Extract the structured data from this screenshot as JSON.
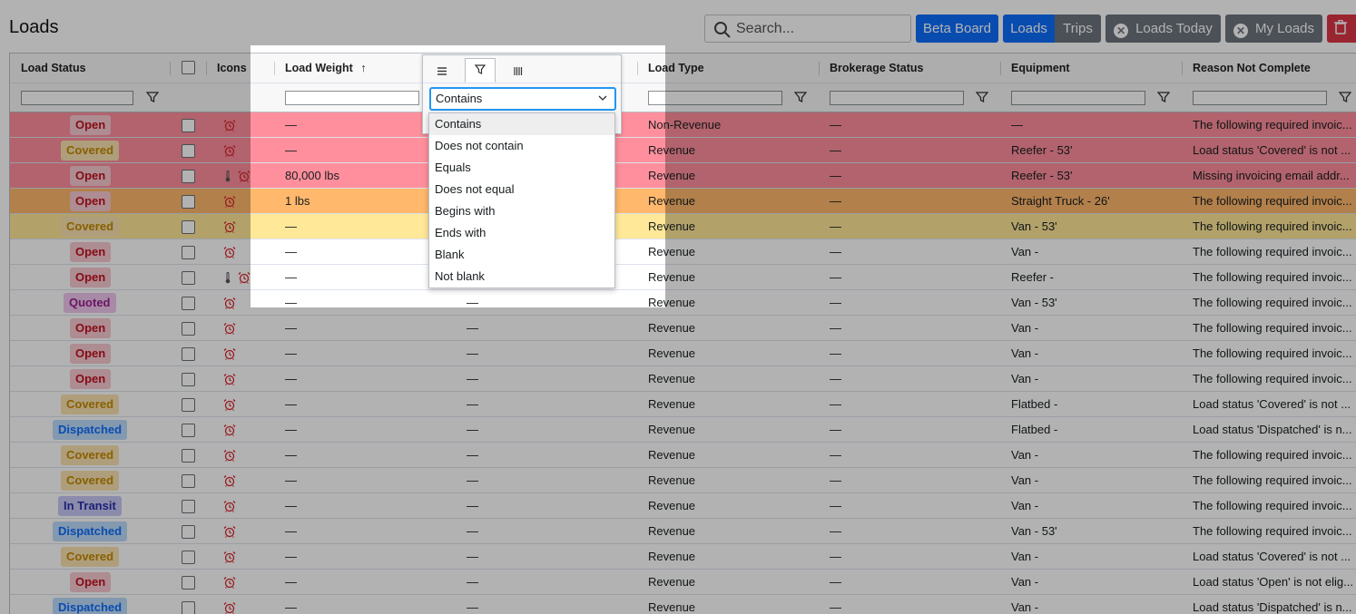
{
  "page": {
    "title": "Loads"
  },
  "search": {
    "placeholder": "Search..."
  },
  "toolbar": {
    "beta_board": "Beta Board",
    "loads": "Loads",
    "trips": "Trips",
    "loads_today": "Loads Today",
    "my_loads": "My Loads",
    "colors": {
      "blue": "#0d6efd",
      "gray": "#6c757d",
      "red": "#dc3545"
    }
  },
  "columns": {
    "load_status": "Load Status",
    "icons": "Icons",
    "load_weight": "Load Weight",
    "load_weight_sort": "↑",
    "load_type": "Load Type",
    "brokerage_status": "Brokerage Status",
    "equipment": "Equipment",
    "reason_not_complete": "Reason Not Complete"
  },
  "filter_menu": {
    "selected": "Contains",
    "options": [
      "Contains",
      "Does not contain",
      "Equals",
      "Does not equal",
      "Begins with",
      "Ends with",
      "Blank",
      "Not blank"
    ]
  },
  "status_colors": {
    "Open": {
      "bg": "#f8c9d1",
      "fg": "#c1121f"
    },
    "Covered": {
      "bg": "#fbe3b0",
      "fg": "#c38a00"
    },
    "Quoted": {
      "bg": "#f0c6ec",
      "fg": "#9b1f8f"
    },
    "Dispatched": {
      "bg": "#bcdcfb",
      "fg": "#0d6efd"
    },
    "In Transit": {
      "bg": "#c7c8f5",
      "fg": "#2b2fa8"
    }
  },
  "row_highlights": {
    "red": "#ff8f9c",
    "orange": "#ffb86c",
    "yellow": "#ffe898"
  },
  "rows": [
    {
      "status": "Open",
      "weight": "—",
      "col5": "",
      "type": "Non-Revenue",
      "brokerage": "—",
      "equipment": "—",
      "reason": "The following required invoic...",
      "hl": "red",
      "thermo": false
    },
    {
      "status": "Covered",
      "weight": "—",
      "col5": "",
      "type": "Revenue",
      "brokerage": "—",
      "equipment": "Reefer - 53'",
      "reason": "Load status 'Covered' is not ...",
      "hl": "red",
      "thermo": false
    },
    {
      "status": "Open",
      "weight": "80,000 lbs",
      "col5": "",
      "type": "Revenue",
      "brokerage": "—",
      "equipment": "Reefer - 53'",
      "reason": "Missing invoicing email addr...",
      "hl": "red",
      "thermo": true
    },
    {
      "status": "Open",
      "weight": "1 lbs",
      "col5": "",
      "type": "Revenue",
      "brokerage": "—",
      "equipment": "Straight Truck - 26'",
      "reason": "The following required invoic...",
      "hl": "orange",
      "thermo": false
    },
    {
      "status": "Covered",
      "weight": "—",
      "col5": "",
      "type": "Revenue",
      "brokerage": "—",
      "equipment": "Van - 53'",
      "reason": "The following required invoic...",
      "hl": "yellow",
      "thermo": false
    },
    {
      "status": "Open",
      "weight": "—",
      "col5": "",
      "type": "Revenue",
      "brokerage": "—",
      "equipment": "Van -",
      "reason": "The following required invoic...",
      "hl": "",
      "thermo": false
    },
    {
      "status": "Open",
      "weight": "—",
      "col5": "",
      "type": "Revenue",
      "brokerage": "—",
      "equipment": "Reefer -",
      "reason": "The following required invoic...",
      "hl": "",
      "thermo": true
    },
    {
      "status": "Quoted",
      "weight": "—",
      "col5": "—",
      "type": "Revenue",
      "brokerage": "—",
      "equipment": "Van - 53'",
      "reason": "The following required invoic...",
      "hl": "",
      "thermo": false
    },
    {
      "status": "Open",
      "weight": "—",
      "col5": "—",
      "type": "Revenue",
      "brokerage": "—",
      "equipment": "Van -",
      "reason": "The following required invoic...",
      "hl": "",
      "thermo": false
    },
    {
      "status": "Open",
      "weight": "—",
      "col5": "—",
      "type": "Revenue",
      "brokerage": "—",
      "equipment": "Van -",
      "reason": "The following required invoic...",
      "hl": "",
      "thermo": false
    },
    {
      "status": "Open",
      "weight": "—",
      "col5": "—",
      "type": "Revenue",
      "brokerage": "—",
      "equipment": "Van -",
      "reason": "The following required invoic...",
      "hl": "",
      "thermo": false
    },
    {
      "status": "Covered",
      "weight": "—",
      "col5": "—",
      "type": "Revenue",
      "brokerage": "—",
      "equipment": "Flatbed -",
      "reason": "Load status 'Covered' is not ...",
      "hl": "",
      "thermo": false
    },
    {
      "status": "Dispatched",
      "weight": "—",
      "col5": "—",
      "type": "Revenue",
      "brokerage": "—",
      "equipment": "Flatbed -",
      "reason": "Load status 'Dispatched' is n...",
      "hl": "",
      "thermo": false
    },
    {
      "status": "Covered",
      "weight": "—",
      "col5": "—",
      "type": "Revenue",
      "brokerage": "—",
      "equipment": "Van -",
      "reason": "The following required invoic...",
      "hl": "",
      "thermo": false
    },
    {
      "status": "Covered",
      "weight": "—",
      "col5": "—",
      "type": "Revenue",
      "brokerage": "—",
      "equipment": "Van -",
      "reason": "The following required invoic...",
      "hl": "",
      "thermo": false
    },
    {
      "status": "In Transit",
      "weight": "—",
      "col5": "—",
      "type": "Revenue",
      "brokerage": "—",
      "equipment": "Van -",
      "reason": "The following required invoic...",
      "hl": "",
      "thermo": false
    },
    {
      "status": "Dispatched",
      "weight": "—",
      "col5": "—",
      "type": "Revenue",
      "brokerage": "—",
      "equipment": "Van - 53'",
      "reason": "The following required invoic...",
      "hl": "",
      "thermo": false
    },
    {
      "status": "Covered",
      "weight": "—",
      "col5": "—",
      "type": "Revenue",
      "brokerage": "—",
      "equipment": "Van -",
      "reason": "Load status 'Covered' is not ...",
      "hl": "",
      "thermo": false
    },
    {
      "status": "Open",
      "weight": "—",
      "col5": "—",
      "type": "Revenue",
      "brokerage": "—",
      "equipment": "Van -",
      "reason": "Load status 'Open' is not elig...",
      "hl": "",
      "thermo": false
    },
    {
      "status": "Dispatched",
      "weight": "—",
      "col5": "—",
      "type": "Revenue",
      "brokerage": "—",
      "equipment": "Van -",
      "reason": "Load status 'Dispatched' is n...",
      "hl": "",
      "thermo": false
    }
  ]
}
